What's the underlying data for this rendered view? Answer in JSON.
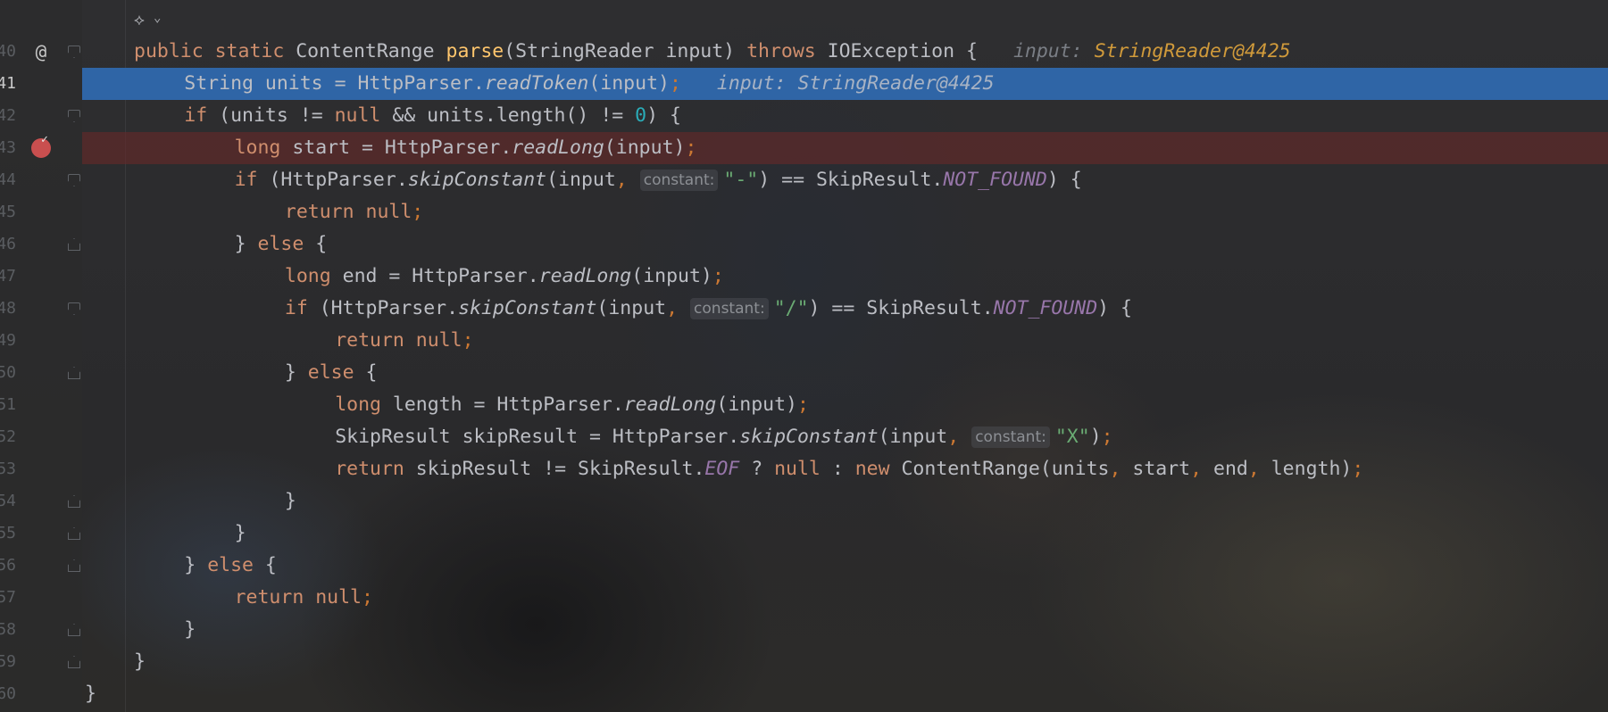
{
  "editor": {
    "toolbar_icon": "ai-assistant-icon",
    "line_numbers": [
      "40",
      "41",
      "42",
      "43",
      "44",
      "45",
      "46",
      "47",
      "48",
      "49",
      "50",
      "51",
      "52",
      "53",
      "54",
      "55",
      "56",
      "57",
      "58",
      "59",
      "60"
    ],
    "current_line": "41",
    "lines": [
      {
        "ln": "40",
        "indent": 0,
        "tokens": [
          [
            "kw",
            "public static "
          ],
          [
            "plain",
            "ContentRange "
          ],
          [
            "decl",
            "parse"
          ],
          [
            "plain",
            "(StringReader input) "
          ],
          [
            "kw",
            "throws "
          ],
          [
            "plain",
            "IOException {"
          ]
        ],
        "inlay_label": "input: ",
        "inlay_value": "StringReader@4425"
      },
      {
        "ln": "41",
        "indent": 1,
        "tokens": [
          [
            "plain",
            "String units = HttpParser."
          ],
          [
            "it",
            "readToken"
          ],
          [
            "plain",
            "(input)"
          ],
          [
            "punct",
            ";"
          ]
        ],
        "inlay_label": "input: StringReader@4425",
        "inlay_value": ""
      },
      {
        "ln": "42",
        "indent": 1,
        "tokens": [
          [
            "kw",
            "if "
          ],
          [
            "plain",
            "(units != "
          ],
          [
            "kw",
            "null "
          ],
          [
            "plain",
            "&& units.length() != "
          ],
          [
            "num",
            "0"
          ],
          [
            "plain",
            ") {"
          ]
        ]
      },
      {
        "ln": "43",
        "indent": 2,
        "tokens": [
          [
            "kw",
            "long "
          ],
          [
            "plain",
            "start = HttpParser."
          ],
          [
            "it",
            "readLong"
          ],
          [
            "plain",
            "(input)"
          ],
          [
            "punct",
            ";"
          ]
        ]
      },
      {
        "ln": "44",
        "indent": 2,
        "tokens": [
          [
            "kw",
            "if "
          ],
          [
            "plain",
            "(HttpParser."
          ],
          [
            "it",
            "skipConstant"
          ],
          [
            "plain",
            "(input"
          ],
          [
            "punct",
            ","
          ],
          [
            "hint",
            "constant:"
          ],
          [
            "str",
            "\"-\""
          ],
          [
            "plain",
            ") == SkipResult."
          ],
          [
            "const",
            "NOT_FOUND"
          ],
          [
            "plain",
            ") {"
          ]
        ]
      },
      {
        "ln": "45",
        "indent": 3,
        "tokens": [
          [
            "kw",
            "return null"
          ],
          [
            "punct",
            ";"
          ]
        ]
      },
      {
        "ln": "46",
        "indent": 2,
        "tokens": [
          [
            "plain",
            "} "
          ],
          [
            "kw",
            "else "
          ],
          [
            "plain",
            "{"
          ]
        ]
      },
      {
        "ln": "47",
        "indent": 3,
        "tokens": [
          [
            "kw",
            "long "
          ],
          [
            "plain",
            "end = HttpParser."
          ],
          [
            "it",
            "readLong"
          ],
          [
            "plain",
            "(input)"
          ],
          [
            "punct",
            ";"
          ]
        ]
      },
      {
        "ln": "48",
        "indent": 3,
        "tokens": [
          [
            "kw",
            "if "
          ],
          [
            "plain",
            "(HttpParser."
          ],
          [
            "it",
            "skipConstant"
          ],
          [
            "plain",
            "(input"
          ],
          [
            "punct",
            ","
          ],
          [
            "hint",
            "constant:"
          ],
          [
            "str",
            "\"/\""
          ],
          [
            "plain",
            ") == SkipResult."
          ],
          [
            "const",
            "NOT_FOUND"
          ],
          [
            "plain",
            ") {"
          ]
        ]
      },
      {
        "ln": "49",
        "indent": 4,
        "tokens": [
          [
            "kw",
            "return null"
          ],
          [
            "punct",
            ";"
          ]
        ]
      },
      {
        "ln": "50",
        "indent": 3,
        "tokens": [
          [
            "plain",
            "} "
          ],
          [
            "kw",
            "else "
          ],
          [
            "plain",
            "{"
          ]
        ]
      },
      {
        "ln": "51",
        "indent": 4,
        "tokens": [
          [
            "kw",
            "long "
          ],
          [
            "plain",
            "length = HttpParser."
          ],
          [
            "it",
            "readLong"
          ],
          [
            "plain",
            "(input)"
          ],
          [
            "punct",
            ";"
          ]
        ]
      },
      {
        "ln": "52",
        "indent": 4,
        "tokens": [
          [
            "plain",
            "SkipResult skipResult = HttpParser."
          ],
          [
            "it",
            "skipConstant"
          ],
          [
            "plain",
            "(input"
          ],
          [
            "punct",
            ","
          ],
          [
            "hint",
            "constant:"
          ],
          [
            "str",
            "\"X\""
          ],
          [
            "plain",
            ")"
          ],
          [
            "punct",
            ";"
          ]
        ]
      },
      {
        "ln": "53",
        "indent": 4,
        "tokens": [
          [
            "kw",
            "return "
          ],
          [
            "plain",
            "skipResult != SkipResult."
          ],
          [
            "const",
            "EOF "
          ],
          [
            "plain",
            "? "
          ],
          [
            "kw",
            "null "
          ],
          [
            "plain",
            ": "
          ],
          [
            "kw",
            "new "
          ],
          [
            "plain",
            "ContentRange(units"
          ],
          [
            "punct",
            ", "
          ],
          [
            "plain",
            "start"
          ],
          [
            "punct",
            ", "
          ],
          [
            "plain",
            "end"
          ],
          [
            "punct",
            ", "
          ],
          [
            "plain",
            "length)"
          ],
          [
            "punct",
            ";"
          ]
        ]
      },
      {
        "ln": "54",
        "indent": 3,
        "tokens": [
          [
            "plain",
            "}"
          ]
        ]
      },
      {
        "ln": "55",
        "indent": 2,
        "tokens": [
          [
            "plain",
            "}"
          ]
        ]
      },
      {
        "ln": "56",
        "indent": 1,
        "tokens": [
          [
            "plain",
            "} "
          ],
          [
            "kw",
            "else "
          ],
          [
            "plain",
            "{"
          ]
        ]
      },
      {
        "ln": "57",
        "indent": 2,
        "tokens": [
          [
            "kw",
            "return null"
          ],
          [
            "punct",
            ";"
          ]
        ]
      },
      {
        "ln": "58",
        "indent": 1,
        "tokens": [
          [
            "plain",
            "}"
          ]
        ]
      },
      {
        "ln": "59",
        "indent": 0,
        "tokens": [
          [
            "plain",
            "}"
          ]
        ]
      },
      {
        "ln": "60",
        "indent": -1,
        "tokens": [
          [
            "plain",
            "}"
          ]
        ]
      }
    ],
    "gutter_markers": {
      "40": "@",
      "43": "breakpoint"
    },
    "fold_markers": {
      "40": "start",
      "42": "start",
      "44": "start",
      "46": "end",
      "48": "start",
      "50": "end",
      "54": "end",
      "55": "end",
      "56": "end",
      "58": "end",
      "59": "end"
    },
    "colors": {
      "execution_line": "#2f65a6",
      "breakpoint_line": "#5a2a2a",
      "keyword": "#cf8e6d",
      "constant": "#9876aa",
      "string": "#6aab73",
      "number": "#2aacb8"
    }
  }
}
